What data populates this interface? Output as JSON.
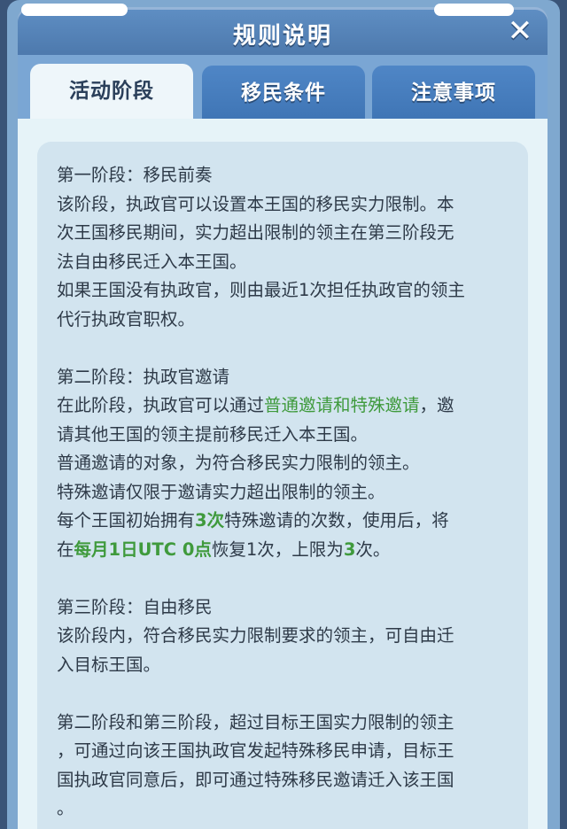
{
  "header": {
    "title": "规则说明",
    "close_glyph": "✕"
  },
  "tabs": [
    {
      "label": "活动阶段",
      "active": true
    },
    {
      "label": "移民条件",
      "active": false
    },
    {
      "label": "注意事项",
      "active": false
    }
  ],
  "colors": {
    "highlight": "#3f9a3c",
    "tab_active_bg": "#eef6fa",
    "tab_inactive_bg": "#4a80c0",
    "header_bg": "#5683b9"
  },
  "rules": {
    "s1": {
      "heading": "第一阶段：移民前奏",
      "line1": "该阶段，执政官可以设置本王国的移民实力限制。本",
      "line2": "次王国移民期间，实力超出限制的领主在第三阶段无",
      "line3": "法自由移民迁入本王国。",
      "line4": "如果王国没有执政官，则由最近1次担任执政官的领主",
      "line5": "代行执政官职权。"
    },
    "s2": {
      "heading": "第二阶段：执政官邀请",
      "l1_pre": "在此阶段，执政官可以通过",
      "l1_hl": "普通邀请和特殊邀请",
      "l1_post": "，邀",
      "line2": "请其他王国的领主提前移民迁入本王国。",
      "line3": "普通邀请的对象，为符合移民实力限制的领主。",
      "line4": "特殊邀请仅限于邀请实力超出限制的领主。",
      "l5_pre": "每个王国初始拥有",
      "l5_hl": "3次",
      "l5_post": "特殊邀请的次数，使用后，将",
      "l6_pre": "在",
      "l6_hl": "每月1日UTC 0点",
      "l6_mid": "恢复1次，上限为",
      "l6_hl2": "3",
      "l6_post": "次。"
    },
    "s3": {
      "heading": "第三阶段：自由移民",
      "line1": "该阶段内，符合移民实力限制要求的领主，可自由迁",
      "line2": "入目标王国。"
    },
    "s4": {
      "line1": "第二阶段和第三阶段，超过目标王国实力限制的领主",
      "line2": "，可通过向该王国执政官发起特殊移民申请，目标王",
      "line3": "国执政官同意后，即可通过特殊移民邀请迁入该王国",
      "line4": "。"
    }
  }
}
